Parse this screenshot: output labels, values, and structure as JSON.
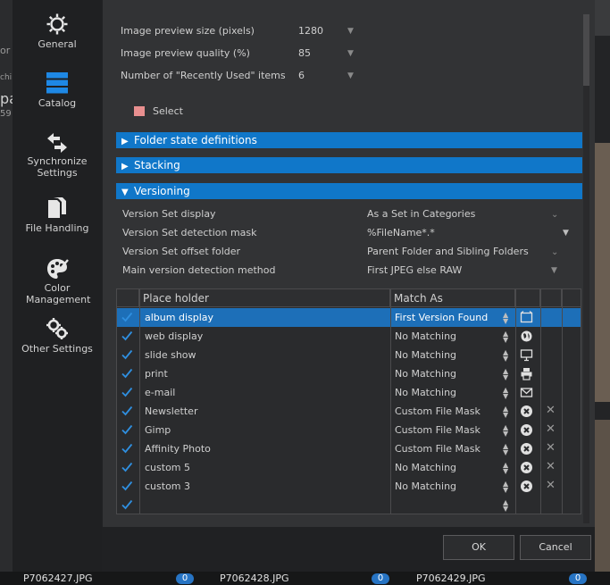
{
  "background": {
    "left_fragments": [
      "or",
      "chi",
      "pa",
      "59"
    ],
    "files": [
      {
        "name": "P7062427.JPG",
        "count": "0"
      },
      {
        "name": "P7062428.JPG",
        "count": "0"
      },
      {
        "name": "P7062429.JPG",
        "count": "0"
      }
    ]
  },
  "sidebar": {
    "items": [
      {
        "label": "General",
        "icon": "gear-icon"
      },
      {
        "label": "Catalog",
        "icon": "catalog-icon"
      },
      {
        "label": "Synchronize Settings",
        "icon": "sync-arrows-icon"
      },
      {
        "label": "File Handling",
        "icon": "files-icon"
      },
      {
        "label": "Color Management",
        "icon": "palette-icon"
      },
      {
        "label": "Other Settings",
        "icon": "gears-icon"
      }
    ]
  },
  "settings": {
    "preview_size": {
      "label": "Image preview size (pixels)",
      "value": "1280"
    },
    "preview_quality": {
      "label": "Image preview quality (%)",
      "value": "85"
    },
    "recent_items": {
      "label": "Number of \"Recently Used\" items",
      "value": "6"
    },
    "select_label": "Select",
    "select_color": "#e88f8f"
  },
  "sections": {
    "folder_state": "Folder state definitions",
    "stacking": "Stacking",
    "versioning": "Versioning"
  },
  "versioning": {
    "display": {
      "label": "Version Set display",
      "value": "As a Set in Categories"
    },
    "mask": {
      "label": "Version Set detection mask",
      "value": "%FileName*.*"
    },
    "offset": {
      "label": "Version Set offset folder",
      "value": "Parent Folder and Sibling Folders"
    },
    "method": {
      "label": "Main version detection method",
      "value": "First JPEG else RAW"
    }
  },
  "table": {
    "headers": {
      "placeholder": "Place holder",
      "match": "Match As"
    },
    "rows": [
      {
        "name": "album display",
        "match": "First Version Found",
        "icon": "album-icon",
        "selected": true,
        "removable": false
      },
      {
        "name": "web display",
        "match": "No Matching",
        "icon": "globe-icon",
        "selected": false,
        "removable": false
      },
      {
        "name": "slide show",
        "match": "No Matching",
        "icon": "monitor-icon",
        "selected": false,
        "removable": false
      },
      {
        "name": "print",
        "match": "No Matching",
        "icon": "printer-icon",
        "selected": false,
        "removable": false
      },
      {
        "name": "e-mail",
        "match": "No Matching",
        "icon": "envelope-icon",
        "selected": false,
        "removable": false
      },
      {
        "name": "Newsletter",
        "match": "Custom File Mask",
        "icon": "custom-icon",
        "selected": false,
        "removable": true
      },
      {
        "name": "Gimp",
        "match": "Custom File Mask",
        "icon": "custom-icon",
        "selected": false,
        "removable": true
      },
      {
        "name": "Affinity Photo",
        "match": "Custom File Mask",
        "icon": "custom-icon",
        "selected": false,
        "removable": true
      },
      {
        "name": "custom 5",
        "match": "No Matching",
        "icon": "custom-icon",
        "selected": false,
        "removable": true
      },
      {
        "name": "custom 3",
        "match": "No Matching",
        "icon": "custom-icon",
        "selected": false,
        "removable": true
      }
    ]
  },
  "footer": {
    "ok": "OK",
    "cancel": "Cancel"
  },
  "colors": {
    "accent": "#1077c9",
    "check": "#2f8fe0"
  }
}
